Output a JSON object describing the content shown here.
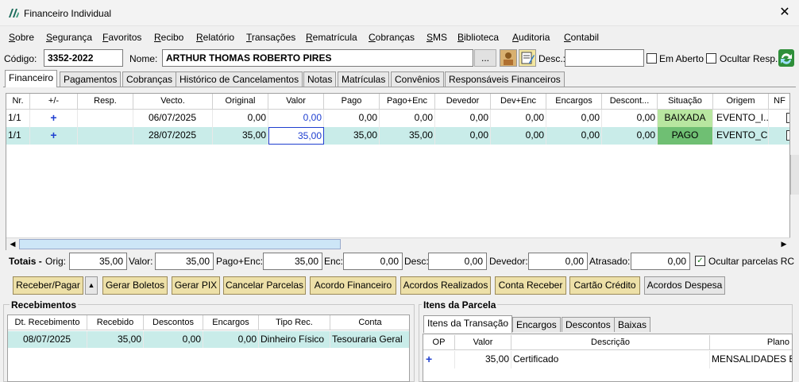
{
  "window": {
    "title": "Financeiro Individual",
    "close": "✕"
  },
  "menu": [
    "Sobre",
    "Segurança",
    "Favoritos",
    "Recibo",
    "Relatório",
    "Transações",
    "Rematrícula",
    "Cobranças",
    "SMS",
    "Biblioteca",
    "Auditoria",
    "Contabil"
  ],
  "header": {
    "codigo_label": "Código:",
    "codigo_value": "3352-2022",
    "nome_label": "Nome:",
    "nome_value": "ARTHUR THOMAS ROBERTO PIRES",
    "dots": "...",
    "desc_label": "Desc.:",
    "desc_value": "",
    "em_aberto_label": "Em Aberto",
    "ocultar_resp_label": "Ocultar Resp."
  },
  "tabs": [
    "Financeiro",
    "Pagamentos",
    "Cobranças",
    "Histórico de Cancelamentos",
    "Notas",
    "Matrículas",
    "Convênios",
    "Responsáveis Financeiros"
  ],
  "grid": {
    "columns": [
      "Nr.",
      "+/-",
      "Resp.",
      "Vecto.",
      "Original",
      "Valor",
      "Pago",
      "Pago+Enc",
      "Devedor",
      "Dev+Enc",
      "Encargos",
      "Descont...",
      "Situação",
      "Origem",
      "NF"
    ],
    "rows": [
      {
        "nr": "1/1",
        "plus": "+",
        "resp": "",
        "vecto": "06/07/2025",
        "original": "0,00",
        "valor": "0,00",
        "pago": "0,00",
        "pago_enc": "0,00",
        "devedor": "0,00",
        "dev_enc": "0,00",
        "encargos": "0,00",
        "descontos": "0,00",
        "situacao": "BAIXADA",
        "origem": "EVENTO_I..."
      },
      {
        "nr": "1/1",
        "plus": "+",
        "resp": "",
        "vecto": "28/07/2025",
        "original": "35,00",
        "valor": "35,00",
        "pago": "35,00",
        "pago_enc": "35,00",
        "devedor": "0,00",
        "dev_enc": "0,00",
        "encargos": "0,00",
        "descontos": "0,00",
        "situacao": "PAGO",
        "origem": "EVENTO_C..."
      }
    ]
  },
  "totais": {
    "label": "Totais -",
    "orig_label": "Orig:",
    "orig": "35,00",
    "valor_label": "Valor:",
    "valor": "35,00",
    "pago_enc_label": "Pago+Enc:",
    "pago_enc": "35,00",
    "enc_label": "Enc:",
    "enc": "0,00",
    "desc_label": "Desc:",
    "desc": "0,00",
    "devedor_label": "Devedor:",
    "devedor": "0,00",
    "atrasado_label": "Atrasado:",
    "atrasado": "0,00",
    "ocultar_label": "Ocultar parcelas RC"
  },
  "actions": {
    "receber_pagar": "Receber/Pagar",
    "gerar_boletos": "Gerar Boletos",
    "gerar_pix": "Gerar PIX",
    "cancelar_parcelas": "Cancelar Parcelas",
    "acordo_financeiro": "Acordo Financeiro",
    "acordos_realizados": "Acordos Realizados",
    "conta_receber": "Conta Receber",
    "cartao_credito": "Cartão Crédito",
    "acordos_despesa": "Acordos Despesa"
  },
  "recebimentos": {
    "title": "Recebimentos",
    "columns": [
      "Dt. Recebimento",
      "Recebido",
      "Descontos",
      "Encargos",
      "Tipo Rec.",
      "Conta"
    ],
    "rows": [
      {
        "dt": "08/07/2025",
        "recebido": "35,00",
        "descontos": "0,00",
        "encargos": "0,00",
        "tipo": "Dinheiro Físico",
        "conta": "Tesouraria Geral"
      }
    ]
  },
  "itens": {
    "title": "Itens da Parcela",
    "tabs": [
      "Itens da Transação",
      "Encargos",
      "Descontos",
      "Baixas"
    ],
    "columns": [
      "OP",
      "Valor",
      "Descrição",
      "Plano"
    ],
    "rows": [
      {
        "op": "+",
        "valor": "35,00",
        "descricao": "Certificado",
        "plano": "MENSALIDADES E"
      }
    ]
  },
  "colors": {
    "baixada": "#b8e6a0",
    "pago": "#6fbf73",
    "selected_row": "#c9ece9",
    "button_gold": "#ede0a8"
  }
}
